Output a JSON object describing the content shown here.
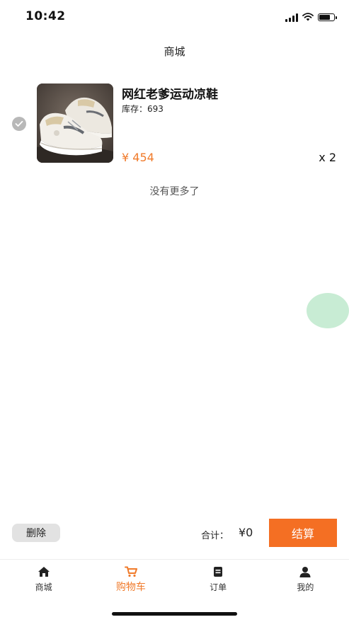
{
  "status_bar": {
    "time": "10:42",
    "icons": [
      "signal-icon",
      "wifi-icon",
      "battery-icon"
    ]
  },
  "nav": {
    "title": "商城"
  },
  "cart": {
    "items": [
      {
        "name": "网红老爹运动凉鞋",
        "stock_label": "库存：",
        "stock": "693",
        "price": "¥ 454",
        "quantity": "x 2",
        "selected": true
      }
    ],
    "no_more_text": "没有更多了"
  },
  "checkout_bar": {
    "delete_label": "删除",
    "total_label": "合计：",
    "total_value": "¥0",
    "checkout_label": "结算"
  },
  "tab_bar": {
    "tabs": [
      {
        "label": "商城",
        "icon": "home-icon",
        "active": false
      },
      {
        "label": "购物车",
        "icon": "cart-icon",
        "active": true
      },
      {
        "label": "订单",
        "icon": "order-icon",
        "active": false
      },
      {
        "label": "我的",
        "icon": "profile-icon",
        "active": false
      }
    ]
  },
  "colors": {
    "accent": "#f46f23",
    "price": "#f07a2a",
    "bubble": "#c8ecd4",
    "check_inactive": "#b8b8b8"
  }
}
